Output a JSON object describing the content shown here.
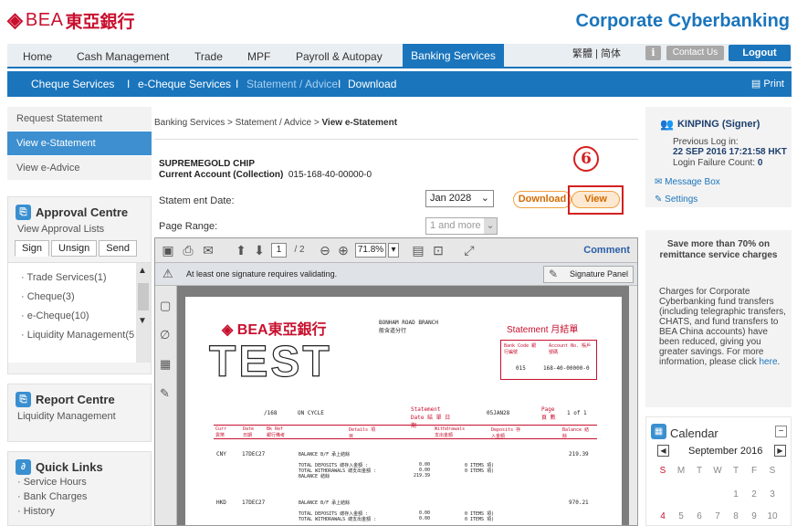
{
  "brand": {
    "mark": "◈",
    "name": "BEA",
    "chinese": "東亞銀行",
    "corporate_title": "Corporate Cyberbanking"
  },
  "topnav": {
    "items": [
      "Home",
      "Cash Management",
      "Trade",
      "MPF",
      "Payroll & Autopay"
    ],
    "active": "Banking Services",
    "lang": "繁體 | 简体",
    "info": "i",
    "contact": "Contact Us",
    "logout": "Logout"
  },
  "subnav": {
    "items": [
      "Cheque Services",
      "e-Cheque Services",
      "Statement / Advice",
      "Download"
    ],
    "sep": "I",
    "print": "Print"
  },
  "leftnav": {
    "items": [
      "Request Statement",
      "View e-Statement",
      "View e-Advice"
    ]
  },
  "approval": {
    "title": "Approval Centre",
    "sub": "View Approval Lists",
    "tabs": [
      "Sign",
      "Unsign",
      "Send"
    ],
    "list": [
      "· Trade Services(1)",
      "· Cheque(3)",
      "· e-Cheque(10)",
      "· Liquidity Management(5"
    ]
  },
  "report": {
    "title": "Report Centre",
    "sub": "Liquidity Management"
  },
  "quick": {
    "title": "Quick Links",
    "links": [
      "· Service Hours",
      "· Bank Charges",
      "· History"
    ]
  },
  "main": {
    "breadcrumb_prefix": "Banking Services > Statement / Advice > ",
    "breadcrumb_current": "View e-Statement",
    "account_name": "SUPREMEGOLD CHIP",
    "account_type": "Current Account (Collection)",
    "account_no": "015-168-40-00000-0",
    "statement_date_label": "Statem ent Date:",
    "statement_date_value": "Jan 2028",
    "download": "Download",
    "view": "View",
    "step": "6",
    "page_range_label": "Page Range:",
    "page_range_value": "1 and more"
  },
  "pdf": {
    "page_input": "1",
    "page_total": "/ 2",
    "zoom": "71.8%",
    "comment": "Comment",
    "sig_msg": "At least one signature requires validating.",
    "sig_panel": "Signature Panel",
    "doc": {
      "test_stamp": "TEST",
      "branch": "BONHAM ROAD BRANCH",
      "branch_cn": "般含道分行",
      "statement": "Statement 月結單",
      "bank_code_label": "Bank Code 銀行編號",
      "account_label": "Account No. 賬戶號碼",
      "bank_code": "015",
      "account_no": "168-40-00000-0",
      "cycle_no": "/168",
      "on_cycle": "ON CYCLE",
      "stmt_date_label": "Statement Date 結 單 日 期",
      "stmt_date": "05JAN28",
      "page_label": "Page 頁 數",
      "page_val": "1  of  1",
      "cols": [
        "Curr 貨幣",
        "Date 日期",
        "Bk Ref 銀行備考",
        "Details 項 目",
        "Withdrawals 支出金額",
        "Deposits 存入金額",
        "Balance 結 餘"
      ],
      "rows": [
        {
          "curr": "CNY",
          "date": "17DEC27",
          "lines": [
            "BALANCE B/F 承上結餘",
            "TOTAL DEPOSITS 總存入金額     :",
            "TOTAL WITHDRAWALS 總支出金額  :",
            "BALANCE 結餘"
          ],
          "w": [
            "",
            "0.00",
            "0.00",
            "219.39"
          ],
          "d": [
            "",
            "0 ITEMS 項)",
            "0 ITEMS 項)",
            ""
          ],
          "bal": "219.39"
        },
        {
          "curr": "HKD",
          "date": "17DEC27",
          "lines": [
            "BALANCE B/F 承上結餘",
            "TOTAL DEPOSITS 總存入金額     :",
            "TOTAL WITHDRAWALS 總支出金額  :"
          ],
          "w": [
            "",
            "0.00",
            "0.00"
          ],
          "d": [
            "",
            "0 ITEMS 項)",
            "0 ITEMS 項)"
          ],
          "bal": "970.21"
        }
      ]
    }
  },
  "user": {
    "name": "KINPING (Signer)",
    "prev_login_label": "Previous Log in:",
    "prev_login": "22 SEP 2016 17:21:58 HKT",
    "fail_label": "Login Failure Count:",
    "fail_count": "0",
    "message_box": "Message Box",
    "settings": "Settings"
  },
  "promo": {
    "title": "Save more than 70% on remittance service charges",
    "body": "Charges for Corporate Cyberbanking fund transfers (including telegraphic transfers, CHATS, and fund transfers to BEA China accounts) have been reduced, giving you greater savings. For more information, please click ",
    "link": "here",
    "end": "."
  },
  "calendar": {
    "title": "Calendar",
    "month": "September 2016",
    "weekdays": [
      "S",
      "M",
      "T",
      "W",
      "T",
      "F",
      "S"
    ],
    "row1": [
      "1",
      "2",
      "3"
    ],
    "row2": [
      "4",
      "5",
      "6",
      "7",
      "8",
      "9",
      "10"
    ]
  },
  "colors": {
    "brand_red": "#c8102e",
    "primary_blue": "#1a75bc",
    "highlight_red": "#d42020",
    "orange": "#d46a00"
  }
}
